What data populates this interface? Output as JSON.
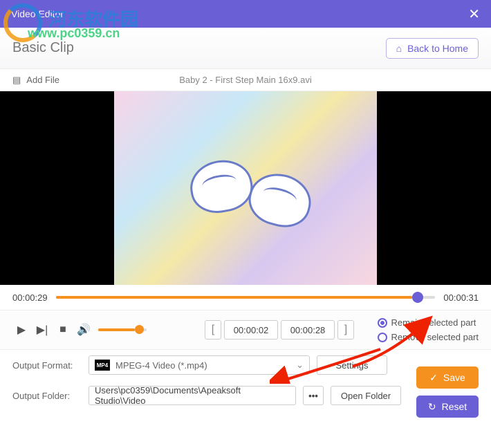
{
  "watermark": {
    "text1": "河东软件园",
    "text2": "www.pc0359.cn"
  },
  "titlebar": {
    "title": "Video Editor"
  },
  "subhead": {
    "breadcrumb": "Basic Clip",
    "home_label": "Back to Home"
  },
  "filebar": {
    "add_label": "Add File",
    "filename": "Baby 2 - First Step Main 16x9.avi"
  },
  "timeline": {
    "current": "00:00:29",
    "total": "00:00:31"
  },
  "clip": {
    "start": "00:00:02",
    "end": "00:00:28"
  },
  "radios": {
    "remain": "Remain selected part",
    "remove": "Remove selected part",
    "selected": "remain"
  },
  "output": {
    "format_label": "Output Format:",
    "format_icon_text": "MP4",
    "format_value": "MPEG-4 Video (*.mp4)",
    "settings_label": "Settings",
    "folder_label": "Output Folder:",
    "folder_value": "Users\\pc0359\\Documents\\Apeaksoft Studio\\Video",
    "browse_label": "•••",
    "open_label": "Open Folder"
  },
  "actions": {
    "save": "Save",
    "reset": "Reset"
  }
}
